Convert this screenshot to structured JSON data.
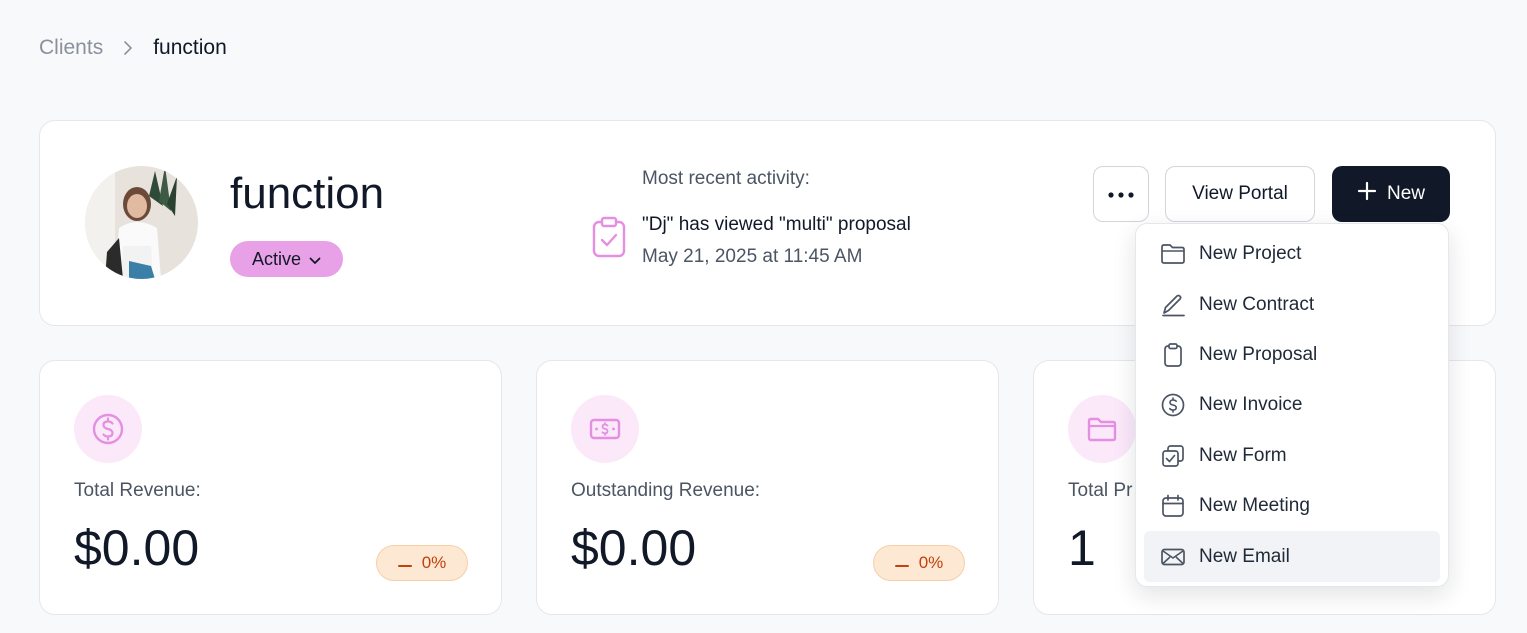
{
  "breadcrumb": {
    "parent": "Clients",
    "current": "function"
  },
  "client": {
    "name": "function",
    "status": "Active"
  },
  "activity": {
    "label": "Most recent activity:",
    "text": "\"Dj\" has viewed \"multi\" proposal",
    "time": "May 21, 2025 at 11:45 AM"
  },
  "actions": {
    "more_icon": "ellipsis-icon",
    "view_portal": "View Portal",
    "new": "New"
  },
  "stats": [
    {
      "label": "Total Revenue:",
      "value": "$0.00",
      "trend": "0%",
      "icon": "dollar-circle-icon"
    },
    {
      "label": "Outstanding Revenue:",
      "value": "$0.00",
      "trend": "0%",
      "icon": "banknote-icon"
    },
    {
      "label": "Total Pr",
      "value": "1",
      "icon": "folder-icon"
    }
  ],
  "menu": {
    "items": [
      {
        "label": "New Project",
        "icon": "folder-icon"
      },
      {
        "label": "New Contract",
        "icon": "pen-icon"
      },
      {
        "label": "New Proposal",
        "icon": "clipboard-icon"
      },
      {
        "label": "New Invoice",
        "icon": "dollar-circle-icon"
      },
      {
        "label": "New Form",
        "icon": "form-check-icon"
      },
      {
        "label": "New Meeting",
        "icon": "calendar-icon"
      },
      {
        "label": "New Email",
        "icon": "mail-icon"
      }
    ],
    "highlighted": "New Email"
  },
  "colors": {
    "primary": "#111827",
    "status_active": "#e8a0e6",
    "accent_icon": "#e48fe2",
    "trend_text": "#c2410c",
    "trend_bg": "#fde8d4"
  }
}
